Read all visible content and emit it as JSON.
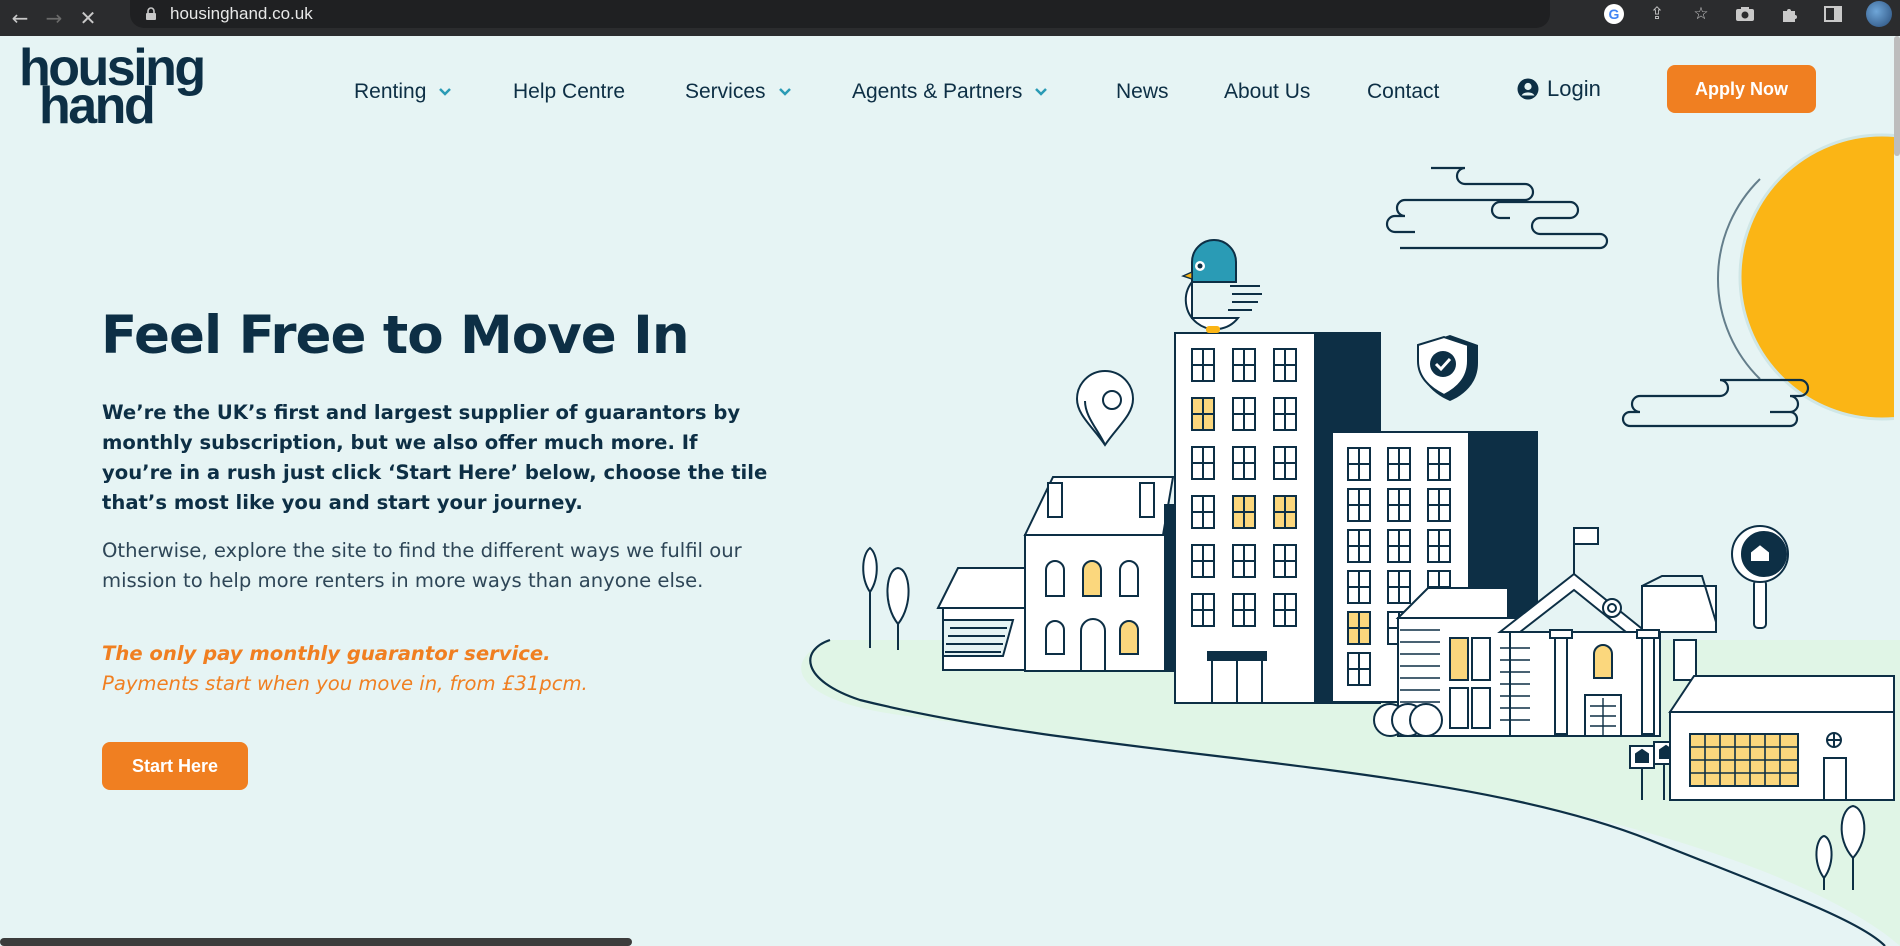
{
  "browser": {
    "url": "housinghand.co.uk"
  },
  "header": {
    "logo_line1": "housing",
    "logo_line2": "hand",
    "nav": {
      "renting": "Renting",
      "help_centre": "Help Centre",
      "services": "Services",
      "agents_partners": "Agents & Partners",
      "news": "News",
      "about": "About Us",
      "contact": "Contact"
    },
    "login": "Login",
    "apply": "Apply Now"
  },
  "hero": {
    "title": "Feel Free to Move In",
    "lead": "We’re the UK’s first and largest supplier of guarantors by monthly subscription, but we also offer much more. If you’re in a rush just click ‘Start Here’ below, choose the tile that’s most like you and start your journey.",
    "body": "Otherwise, explore the site to find the different ways we fulfil our mission to help more renters in more ways than anyone else.",
    "tagline": "The only pay monthly guarantor service.",
    "subline": "Payments start when you move in, from £31pcm.",
    "cta": "Start Here"
  },
  "colors": {
    "background": "#e6f4f4",
    "navy": "#0d2f45",
    "orange": "#f07f21",
    "sun": "#fbb515",
    "window_yellow": "#fbd77d",
    "bird_teal": "#2a9bb5",
    "hill": "#e0f5e6"
  },
  "icons": [
    "back-arrow-icon",
    "forward-arrow-icon",
    "stop-icon",
    "lock-icon",
    "google-icon",
    "share-icon",
    "star-icon",
    "camera-icon",
    "extensions-icon",
    "sidepanel-icon",
    "user-circle-icon",
    "chevron-down-icon"
  ]
}
